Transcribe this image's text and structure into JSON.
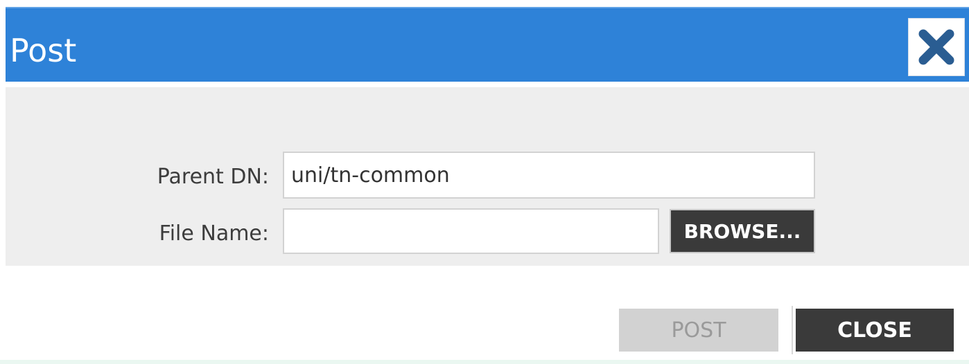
{
  "dialog": {
    "title": "Post",
    "close_icon": "close-x-icon"
  },
  "form": {
    "parent_dn": {
      "label": "Parent DN:",
      "value": "uni/tn-common"
    },
    "file_name": {
      "label": "File Name:",
      "value": ""
    },
    "browse_label": "BROWSE..."
  },
  "footer": {
    "post_label": "POST",
    "close_label": "CLOSE"
  },
  "colors": {
    "title_bar": "#2e82d8",
    "close_icon": "#2a5d92",
    "dark_button": "#3a3a3a",
    "disabled_button": "#d2d2d2"
  }
}
